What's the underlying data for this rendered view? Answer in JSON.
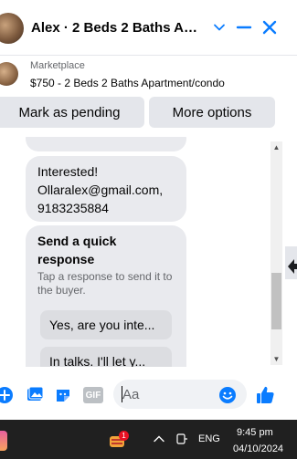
{
  "header": {
    "title": "Alex · 2 Beds 2 Baths Apar...",
    "accent_color": "#0a7cff",
    "icons": [
      "chevron-down-icon",
      "minimize-icon",
      "close-icon"
    ]
  },
  "marketplace": {
    "label": "Marketplace",
    "listing": "$750 - 2 Beds 2 Baths Apartment/condo"
  },
  "actions": {
    "mark_pending": "Mark as pending",
    "more_options": "More options"
  },
  "messages": [
    {
      "text": "Interested! Ollaralex@gmail.com, 9183235884"
    }
  ],
  "quick_response": {
    "title": "Send a quick response",
    "subtitle": "Tap a response to send it to the buyer.",
    "options": [
      "Yes, are you inte...",
      "In talks. I'll let y..."
    ]
  },
  "composer": {
    "placeholder": "Aa",
    "icons": [
      "plus-icon",
      "photo-icon",
      "sticker-icon",
      "gif-icon",
      "emoji-icon",
      "thumbs-up-icon"
    ],
    "gif_label": "GIF"
  },
  "taskbar": {
    "language": "ENG",
    "time": "9:45 pm",
    "date": "04/10/2024",
    "notification_count": "1"
  }
}
